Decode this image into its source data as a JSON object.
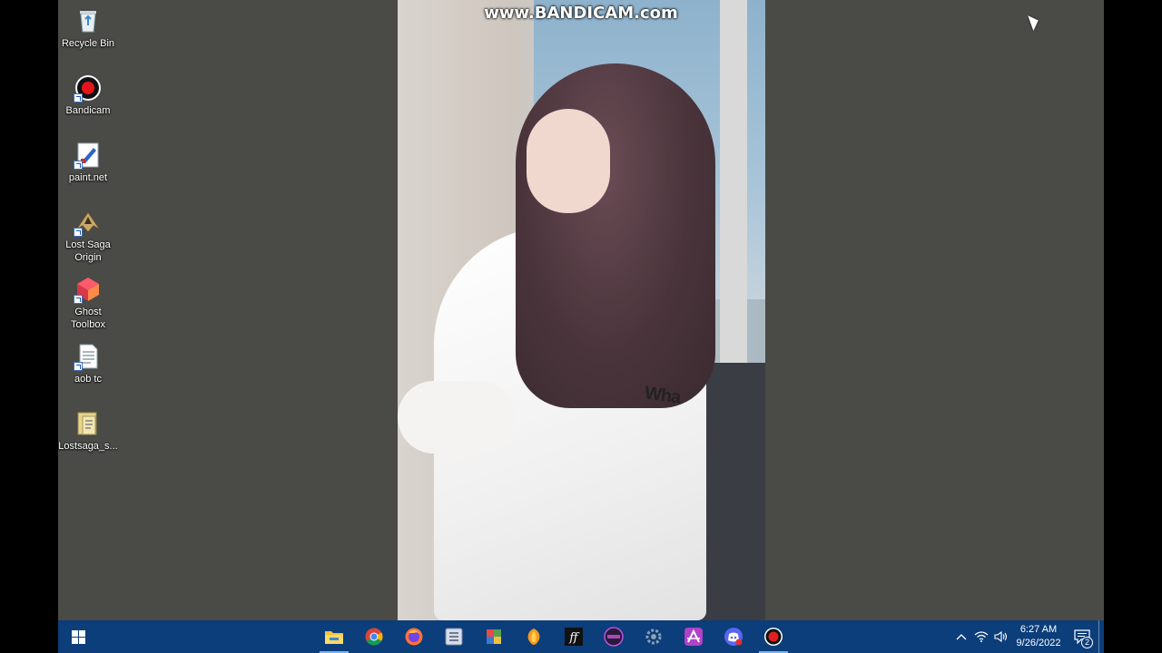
{
  "desktop": {
    "icons": [
      {
        "label": "Recycle Bin",
        "icon": "recycle-bin-icon"
      },
      {
        "label": "Bandicam",
        "icon": "bandicam-icon"
      },
      {
        "label": "paint.net",
        "icon": "paint-net-icon"
      },
      {
        "label": "Lost Saga Origin",
        "icon": "lost-saga-icon"
      },
      {
        "label": "Ghost Toolbox",
        "icon": "ghost-toolbox-icon"
      },
      {
        "label": "aob tc",
        "icon": "text-file-icon"
      },
      {
        "label": "Lostsaga_s...",
        "icon": "folder-file-icon"
      }
    ]
  },
  "watermark": "www.BANDICAM.com",
  "wallpaper": {
    "hoodie_text": "Wha"
  },
  "taskbar": {
    "apps": [
      {
        "name": "file-explorer",
        "icon": "folder-icon",
        "color": "#f6c343"
      },
      {
        "name": "chrome",
        "icon": "chrome-icon",
        "color": "#db4437"
      },
      {
        "name": "firefox",
        "icon": "firefox-icon",
        "color": "#ff7139"
      },
      {
        "name": "app-4",
        "icon": "app-icon",
        "color": "#7a8aa8"
      },
      {
        "name": "app-5",
        "icon": "app-icon",
        "color": "#5aa050"
      },
      {
        "name": "fl-studio",
        "icon": "fl-studio-icon",
        "color": "#f59a23"
      },
      {
        "name": "ff-app",
        "icon": "ff-icon",
        "color": "#111111"
      },
      {
        "name": "touch-app",
        "icon": "touch-icon",
        "color": "#6b2d7a"
      },
      {
        "name": "settings-app",
        "icon": "gear-icon",
        "color": "#8aa0b8"
      },
      {
        "name": "affinity",
        "icon": "affinity-icon",
        "color": "#b042c8"
      },
      {
        "name": "discord",
        "icon": "discord-icon",
        "color": "#5865f2"
      },
      {
        "name": "bandicam",
        "icon": "record-icon",
        "color": "#e02020"
      }
    ],
    "clock": {
      "time": "6:27 AM",
      "date": "9/26/2022"
    },
    "notifications_count": "2"
  }
}
